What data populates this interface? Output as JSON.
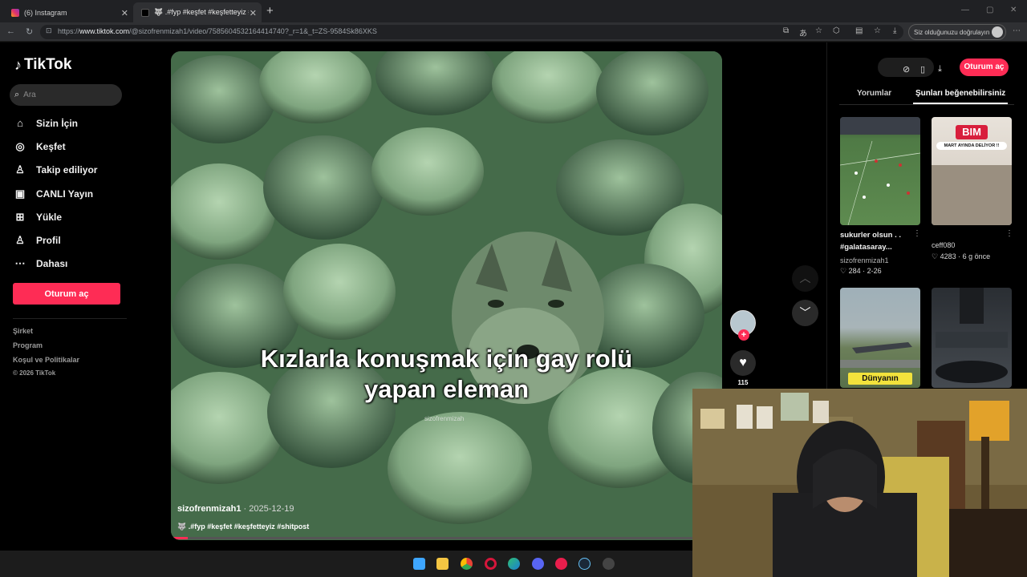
{
  "browser": {
    "tabs": [
      {
        "title": "(6) Instagram",
        "active": false
      },
      {
        "title": "🐺 .#fyp #keşfet #keşfetteyiz #shi",
        "active": true
      }
    ],
    "url_prefix": "https://",
    "url_domain": "www.tiktok.com",
    "url_path": "/@sizofrenmizah1/video/7585604532164414740?_r=1&_t=ZS-9584Sk86XKS",
    "verify_label": "Siz olduğunuzu doğrulayın"
  },
  "tiktok": {
    "logo": "TikTok",
    "search_placeholder": "Ara",
    "nav": [
      {
        "label": "Sizin İçin",
        "icon": "home-icon"
      },
      {
        "label": "Keşfet",
        "icon": "compass-icon"
      },
      {
        "label": "Takip ediliyor",
        "icon": "following-icon"
      },
      {
        "label": "CANLI Yayın",
        "icon": "live-icon"
      },
      {
        "label": "Yükle",
        "icon": "upload-icon"
      },
      {
        "label": "Profil",
        "icon": "profile-icon"
      },
      {
        "label": "Dahası",
        "icon": "more-icon"
      }
    ],
    "login_label": "Oturum aç",
    "footer": [
      "Şirket",
      "Program",
      "Koşul ve Politikalar",
      "© 2026 TikTok"
    ]
  },
  "video": {
    "caption_line1": "Kızlarla konuşmak için gay rolü",
    "caption_line2": "yapan eleman",
    "watermark": "sizofrenmizah",
    "author": "sizofrenmizah1",
    "date": " · 2025-12-19",
    "tags": "🐺 .#fyp #keşfet #keşfetteyiz #shitpost",
    "likes": "115",
    "progress": 0.03
  },
  "right_panel": {
    "login_label": "Oturum aç",
    "tabs": [
      "Yorumlar",
      "Şunları beğenebilirsiniz"
    ],
    "active_tab": "Şunları beğenebilirsiniz",
    "items": [
      {
        "title_line1": "sukurler olsun . .",
        "title_line2": "#galatasaray...",
        "author": "sizofrenmizah1",
        "likes": "284",
        "date": "2-26"
      },
      {
        "author": "ceff080",
        "likes": "4283",
        "date": "6 g önce",
        "thumb_text": "BIM",
        "thumb_subtext": "MART AYINDA DELİYOR !!"
      },
      {
        "thumb_text": "Dünyanın"
      },
      {}
    ]
  },
  "colors": {
    "accent": "#fe2c55",
    "page_bg": "#000000"
  }
}
